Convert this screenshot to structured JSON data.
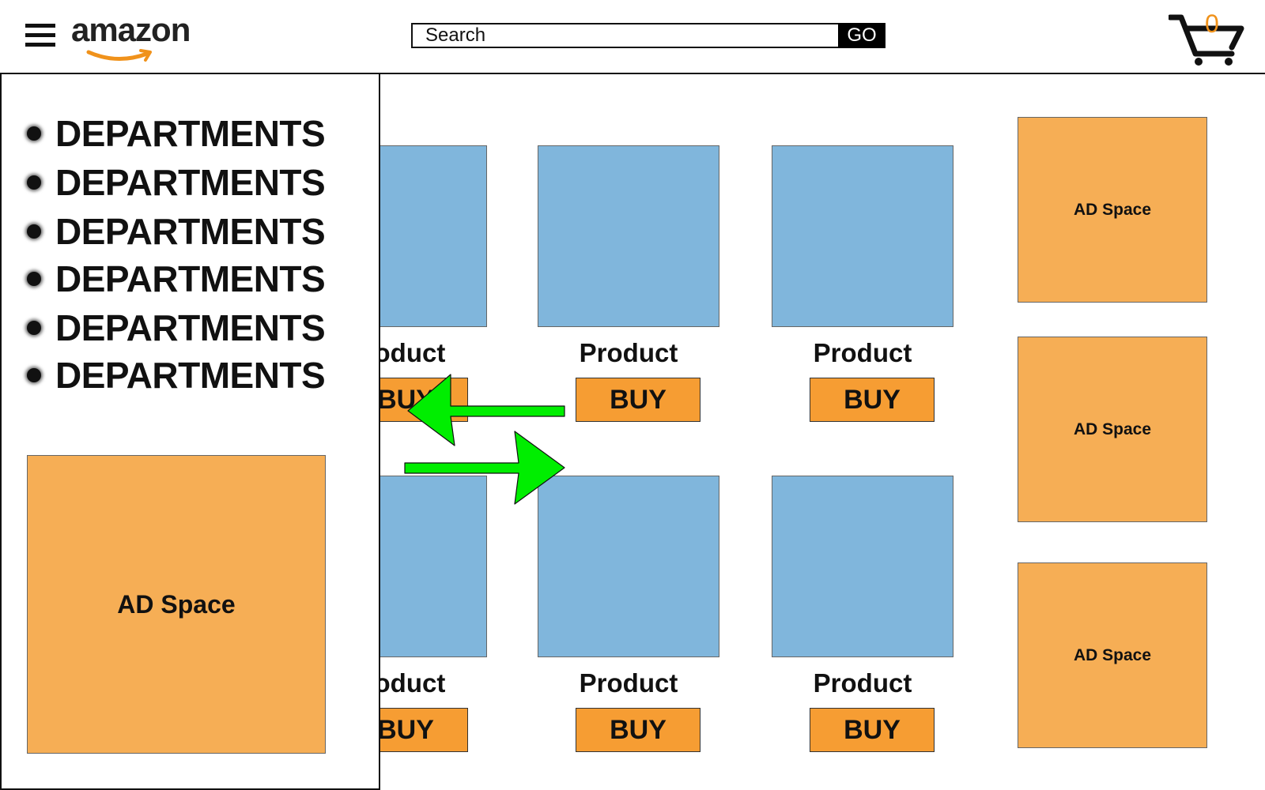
{
  "header": {
    "logo_text": "amazon",
    "search": {
      "placeholder": "Search",
      "value": ""
    },
    "go_label": "GO",
    "cart_count": "0"
  },
  "sidebar": {
    "departments": [
      "DEPARTMENTS",
      "DEPARTMENTS",
      "DEPARTMENTS",
      "DEPARTMENTS",
      "DEPARTMENTS",
      "DEPARTMENTS"
    ],
    "ad_label": "AD Space"
  },
  "products": {
    "visible_partial_name": "oduct",
    "name": "Product",
    "buy_label": "BUY",
    "partial_buy_label": "BUY"
  },
  "right_ads": [
    "AD Space",
    "AD Space",
    "AD Space"
  ],
  "colors": {
    "product_image": "#80b6dc",
    "buy_button": "#f69d33",
    "ad_space": "#f6ae55",
    "arrow": "#00ee00",
    "cart_count": "#f0921b"
  }
}
